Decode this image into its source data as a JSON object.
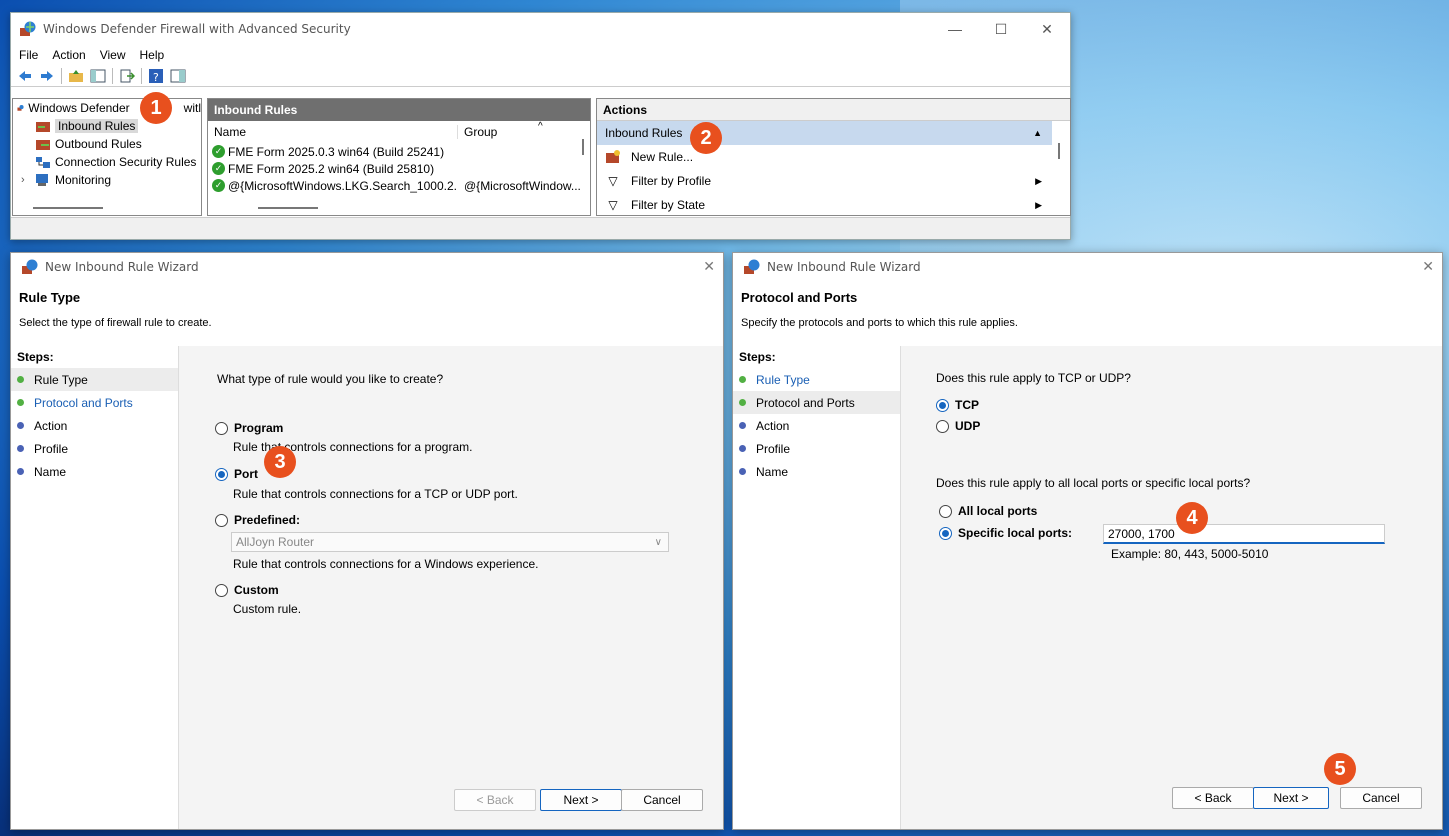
{
  "mmc": {
    "title": "Windows Defender Firewall with Advanced Security",
    "controls": {
      "minimize": "—",
      "maximize": "☐",
      "close": "✕"
    },
    "menu": [
      "File",
      "Action",
      "View",
      "Help"
    ],
    "tree": [
      {
        "label": "Windows Defender Firewall with Advanced Security",
        "visible": "Windows Defender",
        "suffix": "witl"
      },
      {
        "label": "Inbound Rules"
      },
      {
        "label": "Outbound Rules"
      },
      {
        "label": "Connection Security Rules"
      },
      {
        "label": "Monitoring"
      }
    ],
    "center": {
      "header": "Inbound Rules",
      "columns": [
        "Name",
        "Group"
      ],
      "rows": [
        {
          "name": "FME Form 2025.0.3 win64 (Build 25241)",
          "group": ""
        },
        {
          "name": "FME Form 2025.2 win64 (Build 25810)",
          "group": ""
        },
        {
          "name": "@{MicrosoftWindows.LKG.Search_1000.2...",
          "group": "@{MicrosoftWindow..."
        }
      ]
    },
    "actions": {
      "header": "Actions",
      "group": "Inbound Rules",
      "items": [
        "New Rule...",
        "Filter by Profile",
        "Filter by State"
      ]
    }
  },
  "wizard_left": {
    "title": "New Inbound Rule Wizard",
    "heading": "Rule Type",
    "subheading": "Select the type of firewall rule to create.",
    "steps_title": "Steps:",
    "steps": [
      "Rule Type",
      "Protocol and Ports",
      "Action",
      "Profile",
      "Name"
    ],
    "question": "What type of rule would you like to create?",
    "options": [
      {
        "label": "Program",
        "desc": "Rule that controls connections for a program.",
        "selected": false
      },
      {
        "label": "Port",
        "desc": "Rule that controls connections for a TCP or UDP port.",
        "selected": true
      },
      {
        "label": "Predefined:",
        "desc": "Rule that controls connections for a Windows experience.",
        "selected": false
      },
      {
        "label": "Custom",
        "desc": "Custom rule.",
        "selected": false
      }
    ],
    "predefined_value": "AllJoyn Router",
    "buttons": {
      "back": "< Back",
      "next": "Next >",
      "cancel": "Cancel"
    }
  },
  "wizard_right": {
    "title": "New Inbound Rule Wizard",
    "heading": "Protocol and Ports",
    "subheading": "Specify the protocols and ports to which this rule applies.",
    "steps_title": "Steps:",
    "steps": [
      "Rule Type",
      "Protocol and Ports",
      "Action",
      "Profile",
      "Name"
    ],
    "question1": "Does this rule apply to TCP or UDP?",
    "protocols": [
      {
        "label": "TCP",
        "selected": true
      },
      {
        "label": "UDP",
        "selected": false
      }
    ],
    "question2": "Does this rule apply to all local ports or specific local ports?",
    "ports_options": [
      {
        "label": "All local ports",
        "selected": false
      },
      {
        "label": "Specific local ports:",
        "selected": true
      }
    ],
    "ports_value": "27000, 1700",
    "ports_example": "Example: 80, 443, 5000-5010",
    "buttons": {
      "back": "< Back",
      "next": "Next >",
      "cancel": "Cancel"
    }
  },
  "badges": [
    "1",
    "2",
    "3",
    "4",
    "5"
  ],
  "colors": {
    "badge": "#e8501e",
    "accent": "#1565c0",
    "selection": "#c7d9ee"
  }
}
